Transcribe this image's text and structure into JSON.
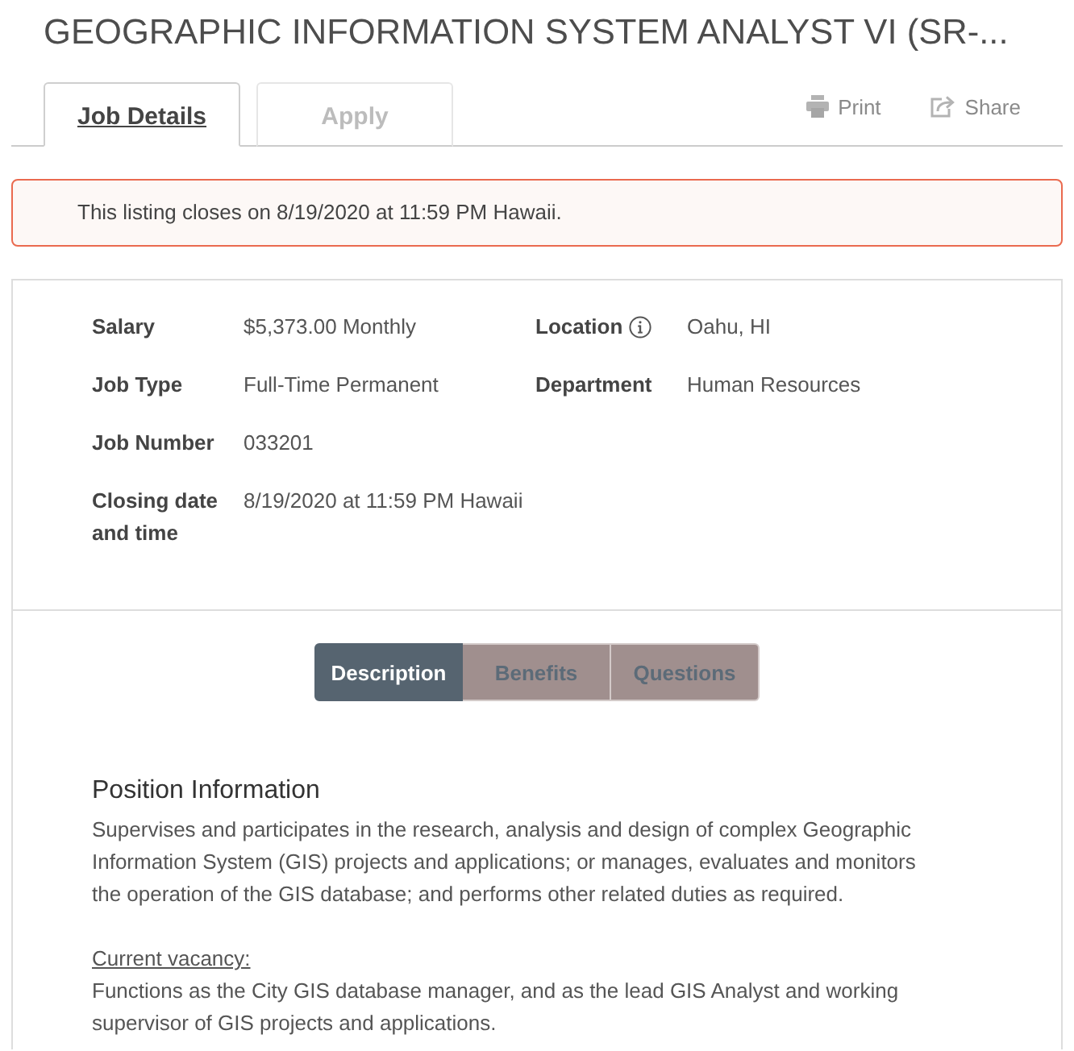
{
  "title": "GEOGRAPHIC INFORMATION SYSTEM ANALYST VI (SR-...",
  "tabs": [
    {
      "label": "Job Details",
      "selected": true
    },
    {
      "label": "Apply",
      "selected": false
    }
  ],
  "actions": [
    {
      "kind": "print",
      "label": "Print"
    },
    {
      "kind": "share",
      "label": "Share"
    }
  ],
  "alert": {
    "text": "This listing closes on 8/19/2020 at 11:59 PM Hawaii."
  },
  "details": [
    [
      {
        "label": "Salary",
        "info": false,
        "value": "$5,373.00 Monthly"
      },
      {
        "label": "Location",
        "info": true,
        "value": "Oahu, HI"
      }
    ],
    [
      {
        "label": "Job Type",
        "info": false,
        "value": "Full-Time Permanent"
      },
      {
        "label": "Department",
        "info": false,
        "value": "Human Resources"
      }
    ],
    [
      {
        "label": "Job Number",
        "info": false,
        "value": "033201"
      }
    ],
    [
      {
        "label": "Closing date and time",
        "info": false,
        "value": "8/19/2020 at 11:59 PM Hawaii"
      }
    ]
  ],
  "section_tabs": [
    {
      "label": "Description",
      "selected": true
    },
    {
      "label": "Benefits",
      "selected": false
    },
    {
      "label": "Questions",
      "selected": false
    }
  ],
  "description": {
    "heading": "Position Information",
    "summary": "Supervises and participates in the research, analysis and design of complex Geographic Information System (GIS) projects and applications; or manages, evaluates and monitors the operation of the GIS database; and performs other related duties as required.",
    "vacancy_label": "Current vacancy:",
    "vacancy_text": "Functions as the City GIS database manager, and as the lead GIS Analyst and working supervisor of GIS projects and applications."
  }
}
